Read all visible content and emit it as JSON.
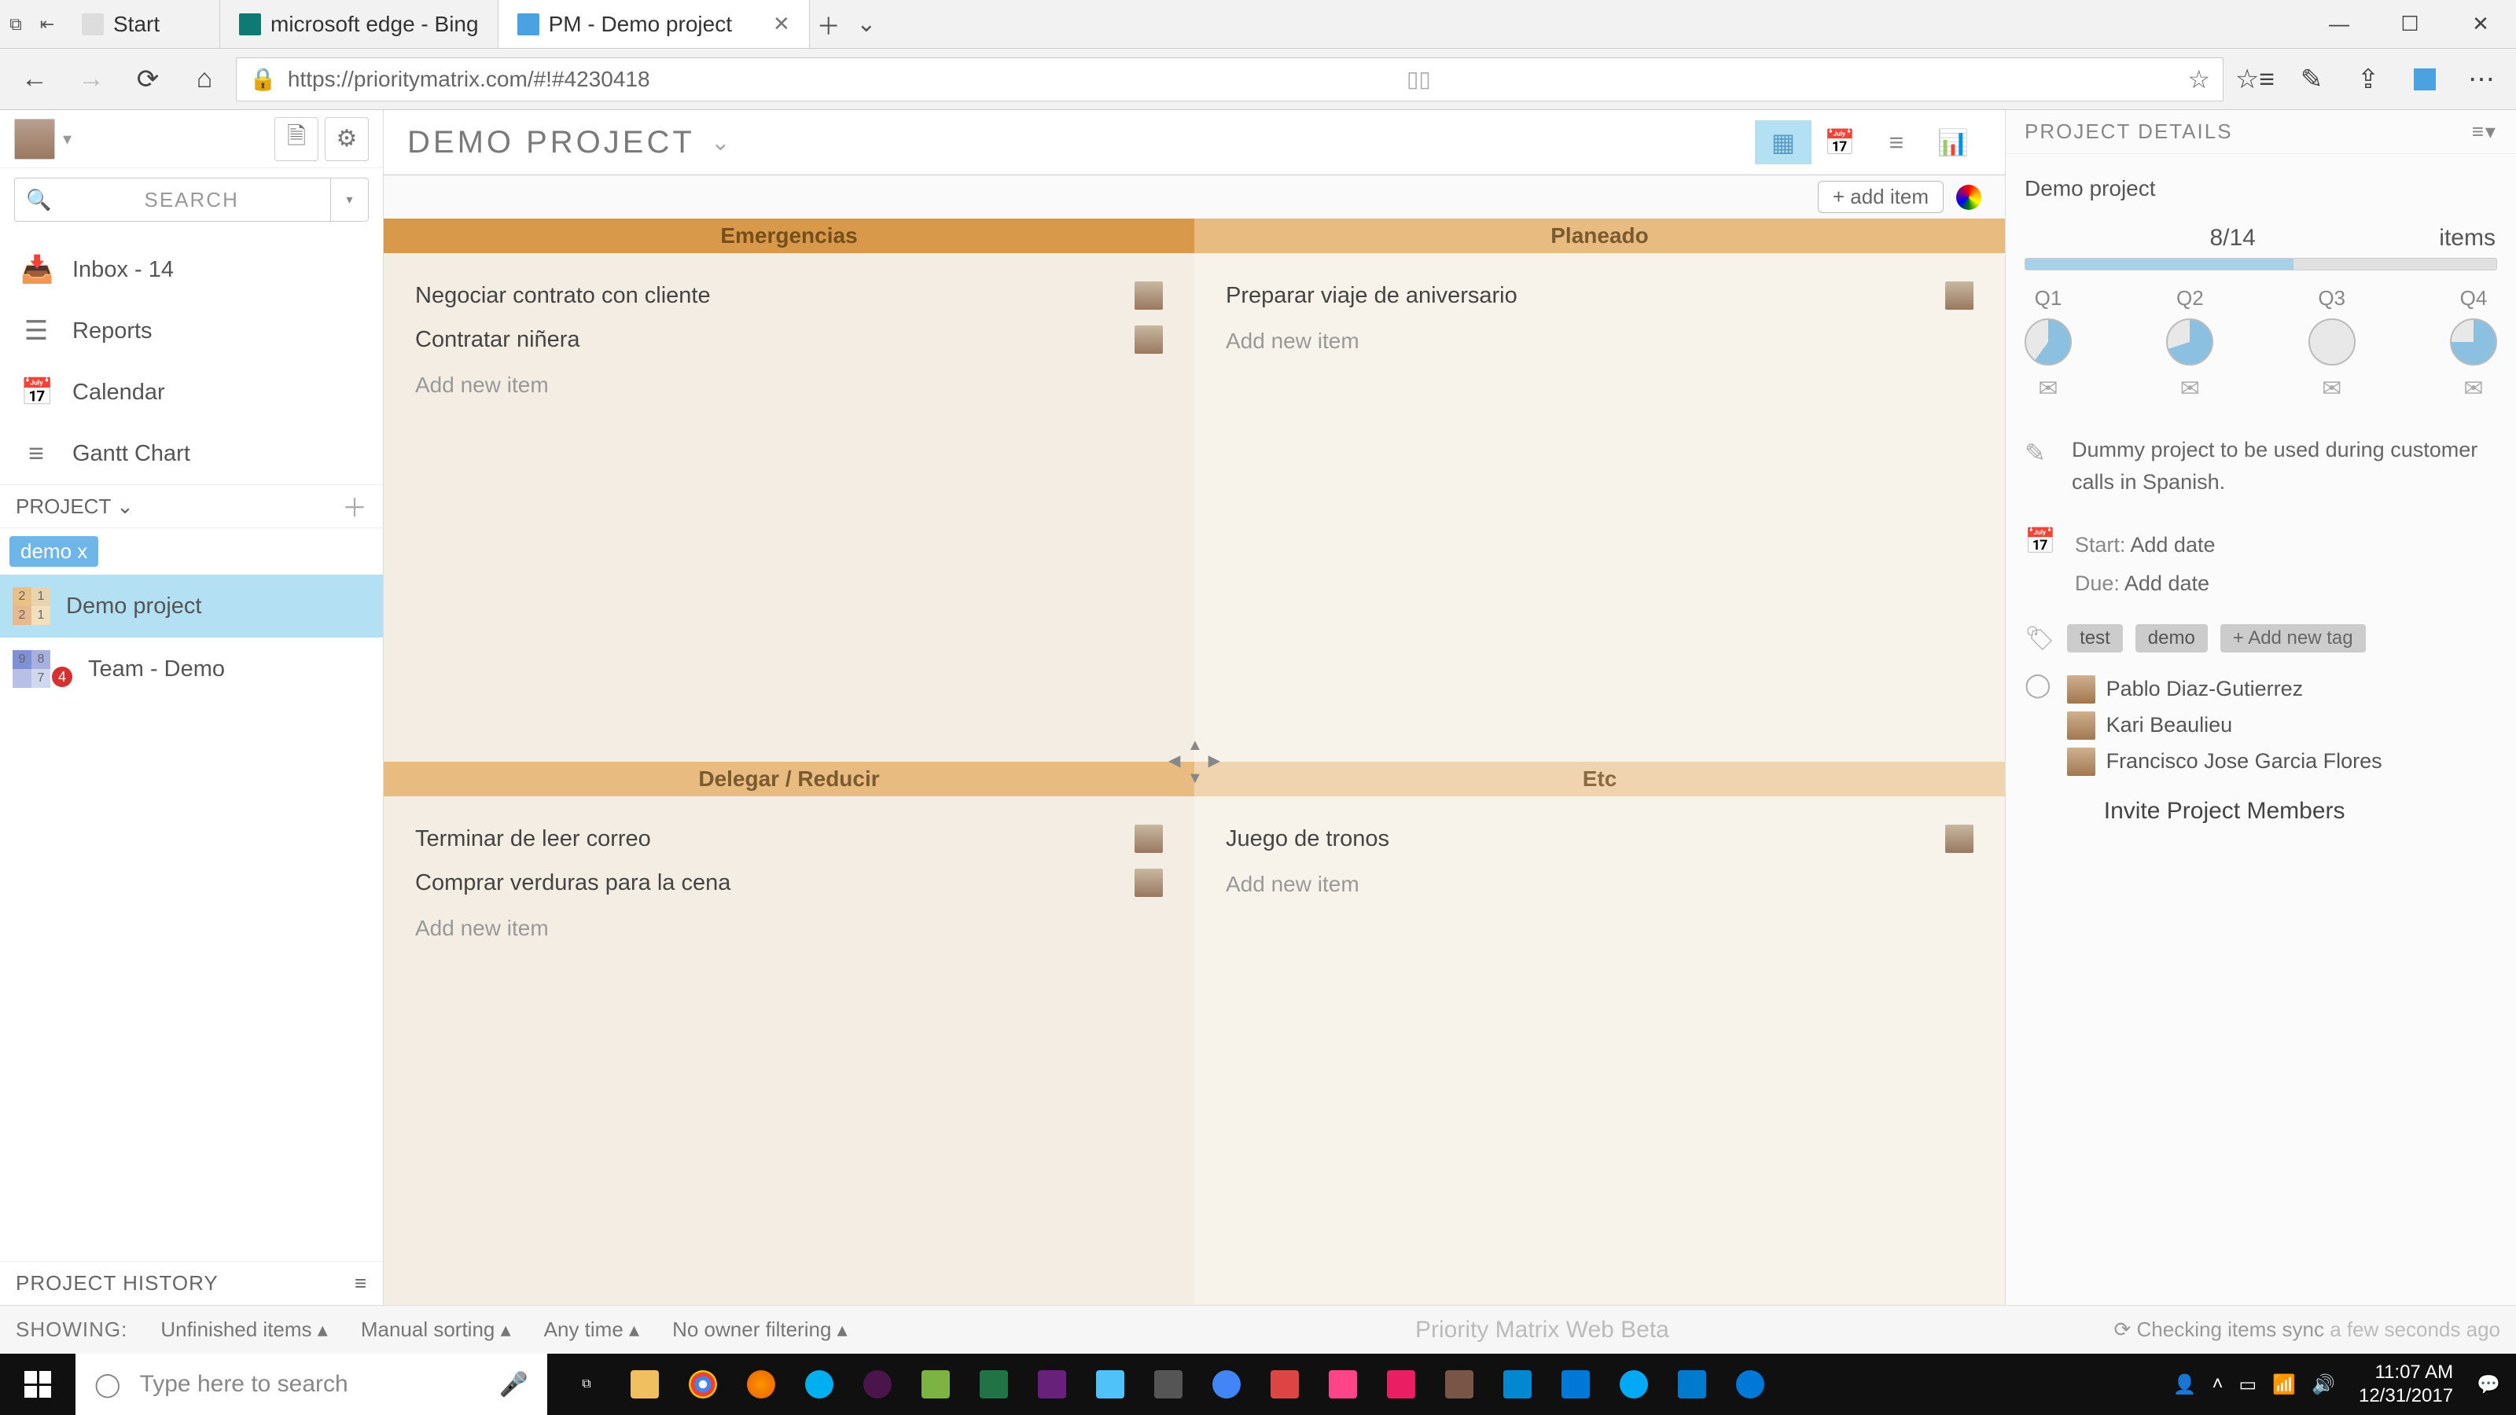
{
  "browser": {
    "tabs": [
      {
        "label": "Start"
      },
      {
        "label": "microsoft edge - Bing"
      },
      {
        "label": "PM - Demo project"
      }
    ],
    "url": "https://prioritymatrix.com/#!#4230418"
  },
  "sidebar": {
    "search_placeholder": "SEARCH",
    "nav": {
      "inbox": "Inbox - 14",
      "reports": "Reports",
      "calendar": "Calendar",
      "gantt": "Gantt Chart"
    },
    "project_header": "PROJECT",
    "filter_chip": "demo x",
    "projects": [
      {
        "name": "Demo project",
        "counts": [
          "2",
          "1",
          "2",
          "1"
        ],
        "active": true
      },
      {
        "name": "Team - Demo",
        "counts": [
          "9",
          "8",
          "",
          "7"
        ],
        "badge": "4"
      }
    ],
    "history": "PROJECT HISTORY"
  },
  "project": {
    "title": "DEMO PROJECT",
    "add_item": "+ add item",
    "quadrants": {
      "q1": {
        "title": "Emergencias",
        "tasks": [
          "Negociar contrato con cliente",
          "Contratar niñera"
        ],
        "add": "Add new item"
      },
      "q2": {
        "title": "Planeado",
        "tasks": [
          "Preparar viaje de aniversario"
        ],
        "add": "Add new item"
      },
      "q3": {
        "title": "Delegar / Reducir",
        "tasks": [
          "Terminar de leer correo",
          "Comprar verduras para la cena"
        ],
        "add": "Add new item"
      },
      "q4": {
        "title": "Etc",
        "tasks": [
          "Juego de tronos"
        ],
        "add": "Add new item"
      }
    }
  },
  "details": {
    "header": "PROJECT DETAILS",
    "name": "Demo project",
    "progress": {
      "count": "8/14",
      "label": "items"
    },
    "quarters": [
      "Q1",
      "Q2",
      "Q3",
      "Q4"
    ],
    "description": "Dummy project to be used during customer calls in Spanish.",
    "start_label": "Start:",
    "start_value": "Add date",
    "due_label": "Due:",
    "due_value": "Add date",
    "tags": [
      "test",
      "demo"
    ],
    "add_tag": "+ Add new tag",
    "members": [
      "Pablo Diaz-Gutierrez",
      "Kari Beaulieu",
      "Francisco Jose Garcia Flores"
    ],
    "invite": "Invite Project Members"
  },
  "filters": {
    "showing": "SHOWING:",
    "f1": "Unfinished items",
    "f2": "Manual sorting",
    "f3": "Any time",
    "f4": "No owner filtering",
    "beta": "Priority Matrix Web Beta",
    "sync_pre": "Checking items sync",
    "sync_suf": "a few seconds ago"
  },
  "taskbar": {
    "search": "Type here to search",
    "time": "11:07 AM",
    "date": "12/31/2017"
  }
}
